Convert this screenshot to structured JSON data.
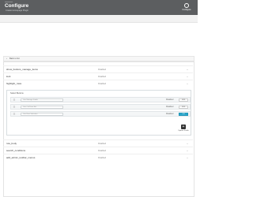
{
  "header": {
    "title": "Configure",
    "subtitle": "Create Homepage Plugin",
    "settings_label": "Configure"
  },
  "back_bar": {
    "icon": "chevron-left-icon",
    "label": "Back to list"
  },
  "rows_top": [
    {
      "label": "show_buttons_manage_items",
      "value": "Disabled"
    },
    {
      "label": "lock",
      "value": "Disabled"
    },
    {
      "label": "highlight_rows",
      "value": "Disabled"
    }
  ],
  "panel": {
    "title": "Select Buttons",
    "rows": [
      {
        "placeholder": "Use Manage Fields",
        "status": "Disabled",
        "button": "OFF",
        "active": false
      },
      {
        "placeholder": "Use Col/View Rel",
        "status": "Disabled",
        "button": "OFF",
        "active": false
      },
      {
        "placeholder": "Use Row Selection",
        "status": "Disabled",
        "button": "ON",
        "active": true
      }
    ],
    "add_label": "Update Fields"
  },
  "rows_bottom": [
    {
      "label": "row_body",
      "value": "Disabled"
    },
    {
      "label": "search_conditions",
      "value": "Disabled"
    },
    {
      "label": "add_admin_toolbar_menus",
      "value": "Disabled"
    }
  ],
  "colors": {
    "header_bg": "#5c5e60",
    "accent": "#2ba6cb"
  }
}
